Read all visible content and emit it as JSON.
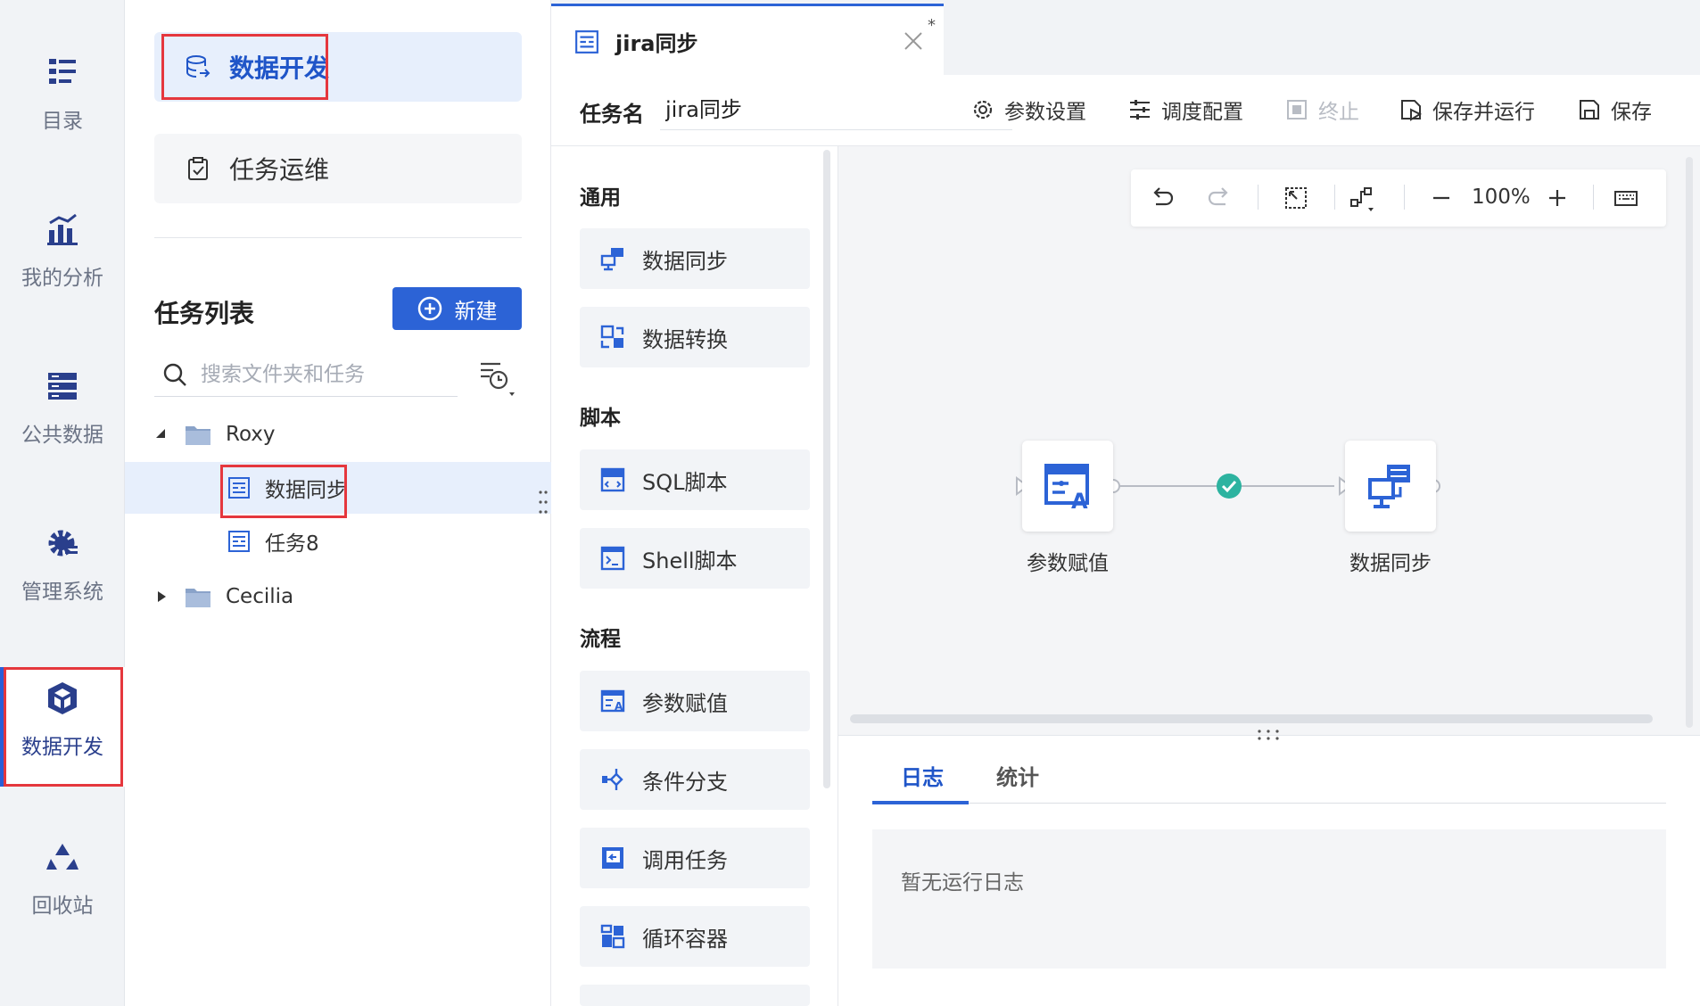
{
  "rail": {
    "items": [
      {
        "label": "目录",
        "icon": "catalog-icon"
      },
      {
        "label": "我的分析",
        "icon": "analysis-icon"
      },
      {
        "label": "公共数据",
        "icon": "public-data-icon"
      },
      {
        "label": "管理系统",
        "icon": "gear-icon"
      },
      {
        "label": "数据开发",
        "icon": "cube-icon",
        "active": true
      },
      {
        "label": "回收站",
        "icon": "recycle-icon"
      }
    ]
  },
  "panel2": {
    "dev_label": "数据开发",
    "ops_label": "任务运维",
    "tasklist_title": "任务列表",
    "new_label": "新建",
    "search_placeholder": "搜索文件夹和任务",
    "tree": {
      "folder1": "Roxy",
      "task1": "数据同步",
      "task2": "任务8",
      "folder2": "Cecilia"
    }
  },
  "editor": {
    "tab_title": "jira同步",
    "tab_modified": "*",
    "taskname_label": "任务名",
    "taskname_value": "jira同步",
    "toolbar": {
      "params": "参数设置",
      "schedule": "调度配置",
      "stop": "终止",
      "save_run": "保存并运行",
      "save": "保存"
    }
  },
  "palette": {
    "sections": {
      "general": "通用",
      "script": "脚本",
      "flow": "流程"
    },
    "items": {
      "data_sync": "数据同步",
      "data_transform": "数据转换",
      "sql_script": "SQL脚本",
      "shell_script": "Shell脚本",
      "param_assign": "参数赋值",
      "condition_branch": "条件分支",
      "call_task": "调用任务",
      "loop_container": "循环容器"
    }
  },
  "canvas": {
    "zoom": "100%",
    "nodes": {
      "node1": "参数赋值",
      "node2": "数据同步"
    }
  },
  "log": {
    "tab_log": "日志",
    "tab_stats": "统计",
    "empty": "暂无运行日志"
  },
  "colors": {
    "accent": "#2c63d6",
    "highlight_box": "#e5373d",
    "success": "#2db3a0"
  }
}
